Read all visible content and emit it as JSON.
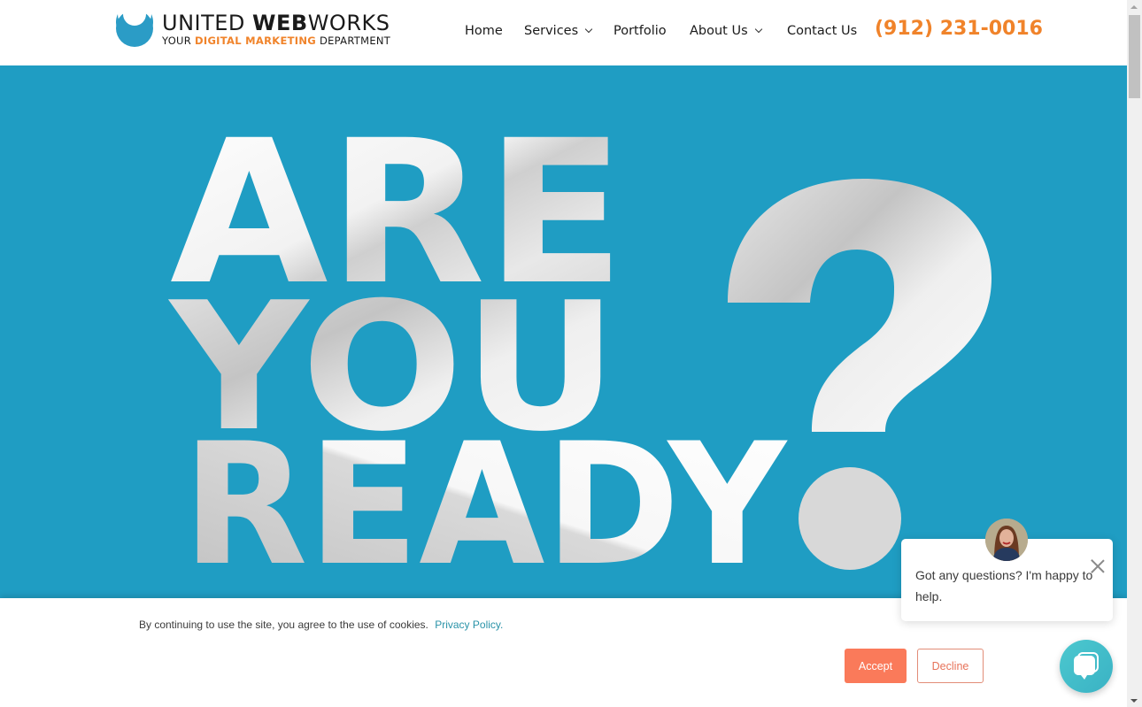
{
  "brand": {
    "title_regular_1": "UNITED ",
    "title_bold": "WEB",
    "title_regular_2": "WORKS",
    "subtitle_1": "YOUR ",
    "subtitle_accent": "DIGITAL MARKETING",
    "subtitle_2": " DEPARTMENT"
  },
  "nav": {
    "items": [
      {
        "label": "Home",
        "has_dropdown": false
      },
      {
        "label": "Services",
        "has_dropdown": true
      },
      {
        "label": "Portfolio",
        "has_dropdown": false
      },
      {
        "label": "About Us",
        "has_dropdown": true
      },
      {
        "label": "Contact Us",
        "has_dropdown": false
      }
    ],
    "phone": "(912) 231-0016"
  },
  "hero": {
    "line1": "ARE",
    "line2": "YOU",
    "line3": "READY",
    "punctuation": "?",
    "background_color": "#1f9dc3"
  },
  "cookie_banner": {
    "message": "By continuing to use the site, you agree to the use of cookies.",
    "link_label": "Privacy Policy.",
    "accept_label": "Accept",
    "decline_label": "Decline"
  },
  "chat": {
    "message": "Got any questions? I'm happy to help.",
    "close_icon": "close-icon",
    "launcher_icon": "chat-bubble-icon"
  },
  "colors": {
    "accent_orange": "#f0832a",
    "brand_blue": "#1f9dc3",
    "accept_button": "#fa7a5a",
    "link_teal": "#2a93a8",
    "chat_teal": "#45bfcb"
  }
}
